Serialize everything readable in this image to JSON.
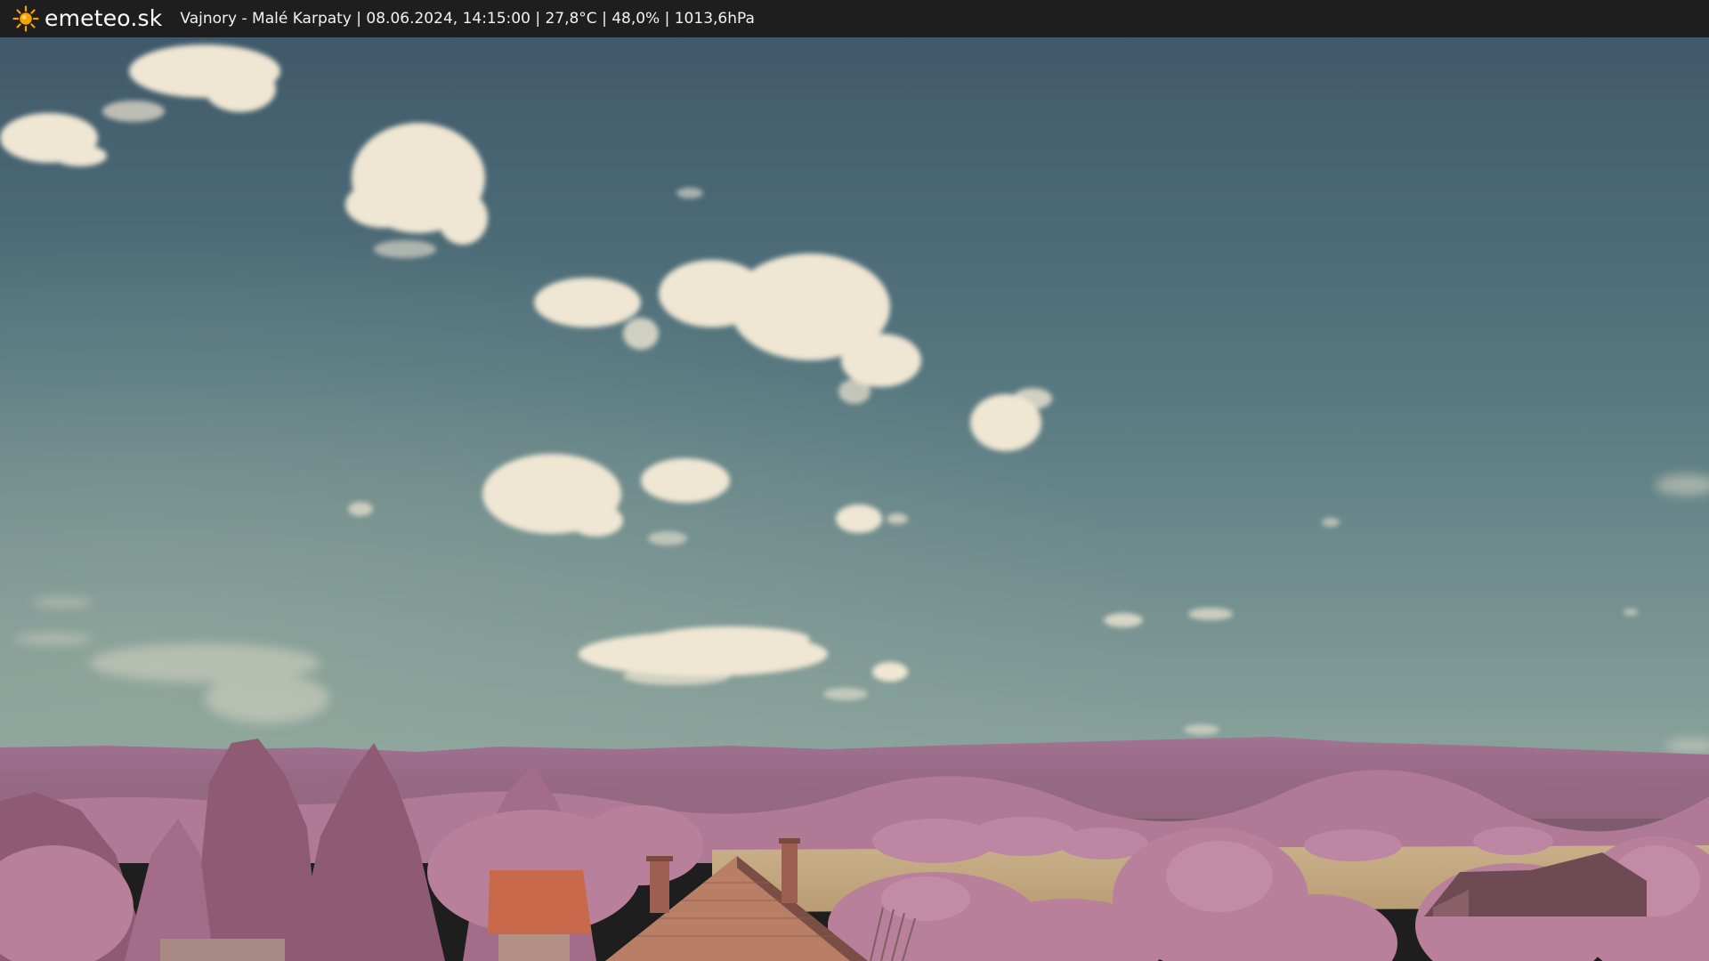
{
  "header": {
    "brand": "emeteo.sk",
    "caption": "Vajnory - Malé Karpaty | 08.06.2024, 14:15:00 | 27,8°C | 48,0% | 1013,6hPa",
    "logo_icon": "sun-icon"
  },
  "colors": {
    "bar_bg": "#1e1e1e",
    "sun": "#f5a300",
    "sky_top": "#3f5a66",
    "sky_bottom": "#7d9797",
    "hills": "#a06e8a",
    "foliage": "#b47a98",
    "field": "#c7ad82",
    "roof": "#c46a4e"
  }
}
